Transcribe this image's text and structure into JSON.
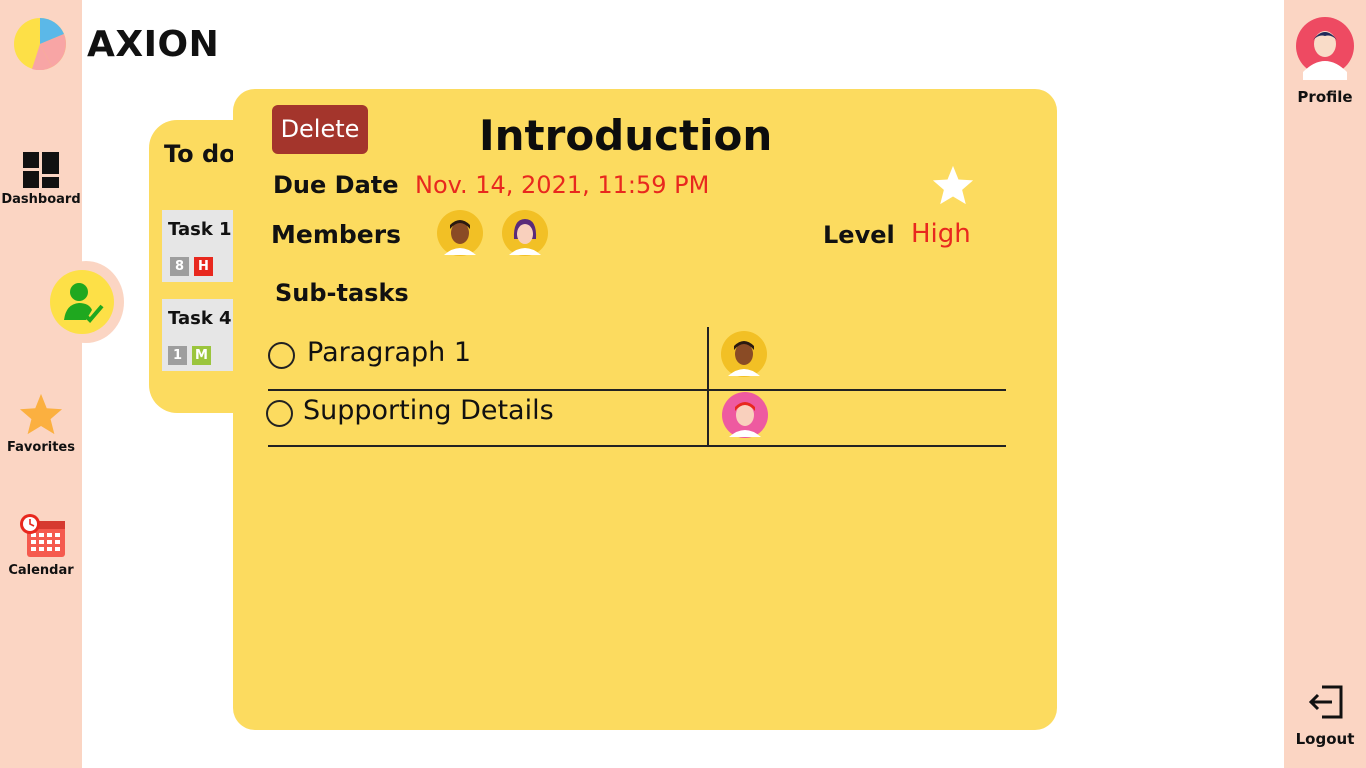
{
  "brand": {
    "name": "AXION"
  },
  "sidebar_left": {
    "items": [
      {
        "label": "Dashboard",
        "icon": "dashboard-grid-icon"
      },
      {
        "label": "",
        "icon": "user-check-icon",
        "active": true
      },
      {
        "label": "Favorites",
        "icon": "star-icon"
      },
      {
        "label": "Calendar",
        "icon": "calendar-clock-icon"
      }
    ]
  },
  "sidebar_right": {
    "profile_label": "Profile",
    "logout_label": "Logout"
  },
  "todo_list": {
    "title": "To do",
    "tasks": [
      {
        "name": "Task 1",
        "count": "8",
        "priority": "H",
        "priority_color": "#e8281e"
      },
      {
        "name": "Task 4",
        "count": "1",
        "priority": "M",
        "priority_color": "#9bc53d"
      }
    ]
  },
  "task_detail": {
    "delete_label": "Delete",
    "title": "Introduction",
    "due_label": "Due Date",
    "due_value": "Nov.  14, 2021, 11:59 PM",
    "favorite_icon": "star-icon",
    "members_label": "Members",
    "members": [
      "member-avatar-male",
      "member-avatar-female"
    ],
    "level_label": "Level",
    "level_value": "High",
    "subtasks_label": "Sub-tasks",
    "subtasks": [
      {
        "text": "Paragraph 1",
        "assignee": "male-avatar"
      },
      {
        "text": "Supporting Details",
        "assignee": "red-hair-avatar"
      }
    ]
  },
  "colors": {
    "sidebar_bg": "#fbd5c3",
    "card_bg": "#fcdb5f",
    "delete_bg": "#a4352c",
    "accent_red": "#e8281e"
  }
}
